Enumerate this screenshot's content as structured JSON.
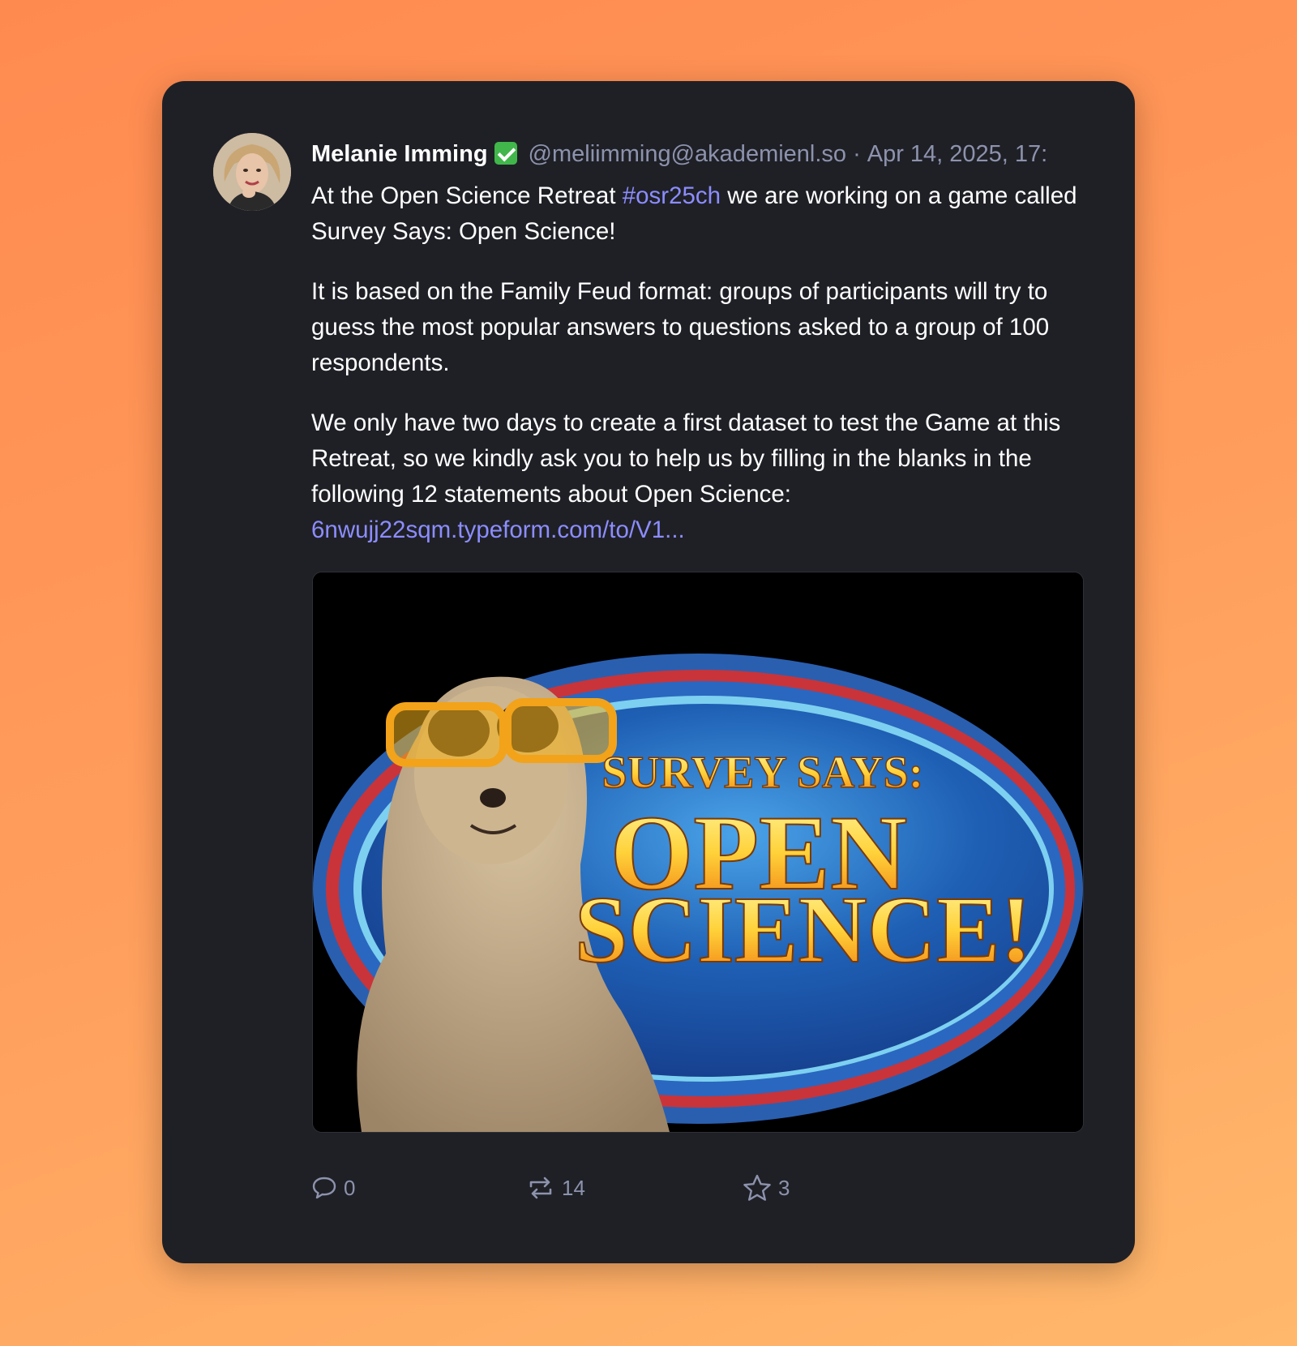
{
  "post": {
    "author_name": "Melanie Imming",
    "verified_emoji": "✅",
    "handle": "@meliimming@akademienl.so",
    "separator": "·",
    "timestamp": "Apr 14, 2025, 17:",
    "body": {
      "p1_before": "At the Open Science Retreat ",
      "hashtag": "#osr25ch",
      "p1_after": " we are working on a game called Survey Says: Open Science!",
      "p2": "It is based on the Family Feud format: groups of participants will try to guess the most popular answers to questions asked to a group of 100 respondents.",
      "p3": "We only have two days to create a first dataset to test the Game at this Retreat, so we kindly ask you to help us by filling in the blanks in the following 12 statements about Open Science:",
      "link": "6nwujj22sqm.typeform.com/to/V1..."
    },
    "media": {
      "line1": "SURVEY SAYS:",
      "line2": "OPEN",
      "line3": "SCIENCE!"
    },
    "actions": {
      "replies": "0",
      "boosts": "14",
      "favourites": "3"
    }
  },
  "colors": {
    "card_bg": "#1f2026",
    "link": "#8c8dff",
    "muted": "#8d93ad",
    "page_gradient_start": "#ff8a50",
    "page_gradient_end": "#ffb86c"
  }
}
